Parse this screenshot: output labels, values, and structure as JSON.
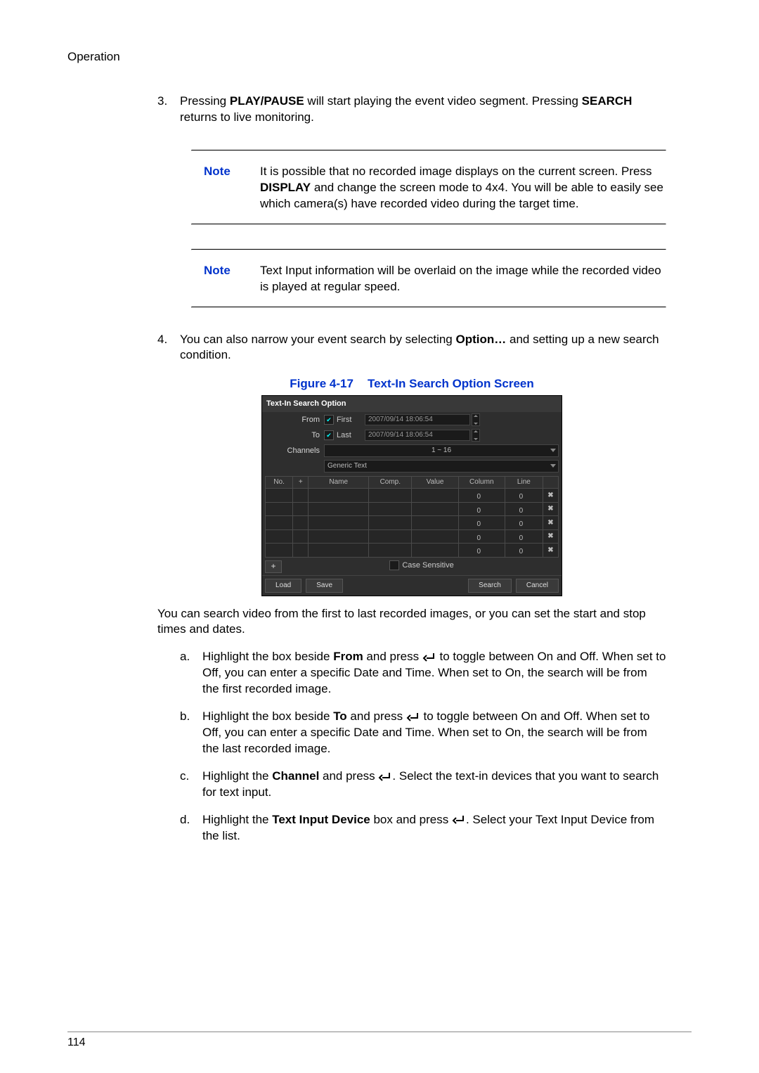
{
  "header": {
    "section": "Operation"
  },
  "step3": {
    "num": "3.",
    "text_pre": "Pressing ",
    "bold1": "PLAY/PAUSE",
    "text_mid": " will start playing the event video segment. Pressing ",
    "bold2": "SEARCH",
    "text_post": " returns to live monitoring."
  },
  "note1": {
    "label": "Note",
    "text_a": "It is possible that no recorded image displays on the current screen. Press ",
    "bold": "DISPLAY",
    "text_b": " and change the screen mode to 4x4. You will be able to easily see which camera(s) have recorded video during the target time."
  },
  "note2": {
    "label": "Note",
    "text": "Text Input information will be overlaid on the image while the recorded video is played at regular speed."
  },
  "step4": {
    "num": "4.",
    "text_a": "You can also narrow your event search by selecting ",
    "bold": "Option…",
    "text_b": " and setting up a new search condition."
  },
  "figure": {
    "num": "Figure 4-17",
    "title": "Text-In Search Option Screen"
  },
  "shot": {
    "title": "Text-In Search Option",
    "from_label": "From",
    "first": "First",
    "date1": "2007/09/14  18:06:54",
    "to_label": "To",
    "last": "Last",
    "date2": "2007/09/14  18:06:54",
    "channels_label": "Channels",
    "channels_value": "1 ~ 16",
    "device": "Generic Text",
    "thead": {
      "no": "No.",
      "plus": "+",
      "name": "Name",
      "comp": "Comp.",
      "value": "Value",
      "column": "Column",
      "line": "Line"
    },
    "zero": "0",
    "x": "✖",
    "cs": "Case Sensitive",
    "load": "Load",
    "save": "Save",
    "search": "Search",
    "cancel": "Cancel",
    "plusbtn": "+"
  },
  "after_fig": "You can search video from the first to last recorded images, or you can set the start and stop times and dates.",
  "sub_a": {
    "letter": "a.",
    "a": "Highlight the box beside ",
    "b1": "From",
    "c": " and press ",
    "d": " to toggle between On and Off. When set to Off, you can enter a specific Date and Time. When set to On, the search will be from the first recorded image."
  },
  "sub_b": {
    "letter": "b.",
    "a": "Highlight the box beside ",
    "b1": "To",
    "c": " and press ",
    "d": " to toggle between On and Off. When set to Off, you can enter a specific Date and Time. When set to On, the search will be from the last recorded image."
  },
  "sub_c": {
    "letter": "c.",
    "a": "Highlight the ",
    "b1": "Channel",
    "c": " and press ",
    "d": ". Select the text-in devices that you want to search for text input."
  },
  "sub_d": {
    "letter": "d.",
    "a": "Highlight the ",
    "b1": "Text Input Device",
    "c": " box and press ",
    "d": ". Select your Text Input Device from the list."
  },
  "page_num": "114"
}
